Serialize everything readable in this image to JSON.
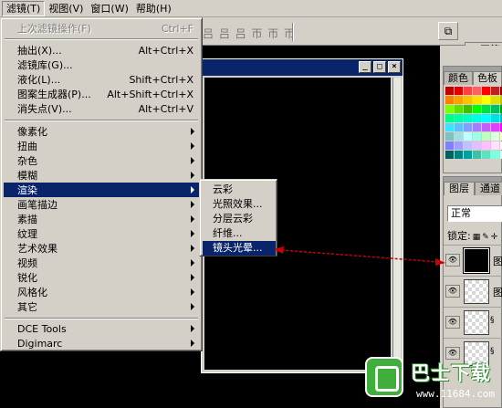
{
  "menubar": {
    "items": [
      {
        "label": "滤镜(T)"
      },
      {
        "label": "视图(V)"
      },
      {
        "label": "窗口(W)"
      },
      {
        "label": "帮助(H)"
      }
    ]
  },
  "options_bar": {
    "align_glyphs": "吕 吕 吕  帀 帀 帀",
    "right_tab": "画笔"
  },
  "filter_menu": {
    "last_filter": {
      "label": "上次滤镜操作(F)",
      "shortcut": "Ctrl+F"
    },
    "group1": [
      {
        "label": "抽出(X)...",
        "shortcut": "Alt+Ctrl+X"
      },
      {
        "label": "滤镜库(G)...",
        "shortcut": ""
      },
      {
        "label": "液化(L)...",
        "shortcut": "Shift+Ctrl+X"
      },
      {
        "label": "图案生成器(P)...",
        "shortcut": "Alt+Shift+Ctrl+X"
      },
      {
        "label": "消失点(V)...",
        "shortcut": "Alt+Ctrl+V"
      }
    ],
    "group2": [
      {
        "label": "像素化"
      },
      {
        "label": "扭曲"
      },
      {
        "label": "杂色"
      },
      {
        "label": "模糊"
      },
      {
        "label": "渲染"
      },
      {
        "label": "画笔描边"
      },
      {
        "label": "素描"
      },
      {
        "label": "纹理"
      },
      {
        "label": "艺术效果"
      },
      {
        "label": "视频"
      },
      {
        "label": "锐化"
      },
      {
        "label": "风格化"
      },
      {
        "label": "其它"
      }
    ],
    "group3": [
      {
        "label": "DCE Tools"
      },
      {
        "label": "Digimarc"
      }
    ],
    "highlighted": "渲染"
  },
  "render_submenu": {
    "items": [
      {
        "label": "云彩"
      },
      {
        "label": "光照效果..."
      },
      {
        "label": "分层云彩"
      },
      {
        "label": "纤维..."
      },
      {
        "label": "镜头光晕..."
      }
    ],
    "highlighted": "镜头光晕..."
  },
  "document_window": {
    "buttons": {
      "minimize": "_",
      "maximize": "□",
      "close": "×"
    }
  },
  "color_palette": {
    "tabs": [
      {
        "label": "颜色"
      },
      {
        "label": "色板"
      }
    ],
    "swatches": [
      "#c00000",
      "#e00000",
      "#ff4040",
      "#ff6060",
      "#ff0000",
      "#c02020",
      "#a00000",
      "#ff8000",
      "#ffa000",
      "#ffc000",
      "#ffe000",
      "#ffff00",
      "#e0e000",
      "#c0c000",
      "#80ff00",
      "#60e000",
      "#40c000",
      "#00ff00",
      "#00e040",
      "#00c060",
      "#00a000",
      "#00ff80",
      "#00ffa0",
      "#00ffc0",
      "#00ffe0",
      "#00ffff",
      "#00e0e0",
      "#00c0c0",
      "#40e0ff",
      "#60c0ff",
      "#80a0ff",
      "#a080ff",
      "#c060ff",
      "#e040ff",
      "#ff00ff",
      "#80c0c0",
      "#a0e0e0",
      "#c0ffff",
      "#a0ffe0",
      "#c0ffc0",
      "#e0ffe0",
      "#ffffc0",
      "#8080ff",
      "#a0a0ff",
      "#c0c0ff",
      "#e0c0ff",
      "#ffc0ff",
      "#ffe0ff",
      "#ffffff",
      "#006060",
      "#008080",
      "#00a0a0",
      "#40c0a0",
      "#60e0c0",
      "#80ffe0",
      "#e0ffff"
    ]
  },
  "layers_palette": {
    "tabs": [
      {
        "label": "图层"
      },
      {
        "label": "通道"
      }
    ],
    "blend_mode": "正常",
    "lock_label": "锁定:",
    "layers": [
      {
        "name": "图",
        "thumb": "black",
        "selected": true
      },
      {
        "name": "图",
        "thumb": "transparent",
        "selected": false
      },
      {
        "name": "",
        "thumb": "transparent",
        "selected": false
      },
      {
        "name": "",
        "thumb": "transparent",
        "selected": false
      }
    ]
  },
  "watermark": {
    "name": "巴士下载",
    "url": "www.11684.com"
  },
  "colors": {
    "menu_bg": "#d4d0c8",
    "highlight": "#0a246a",
    "annotation_arrow": "#cc0000"
  }
}
